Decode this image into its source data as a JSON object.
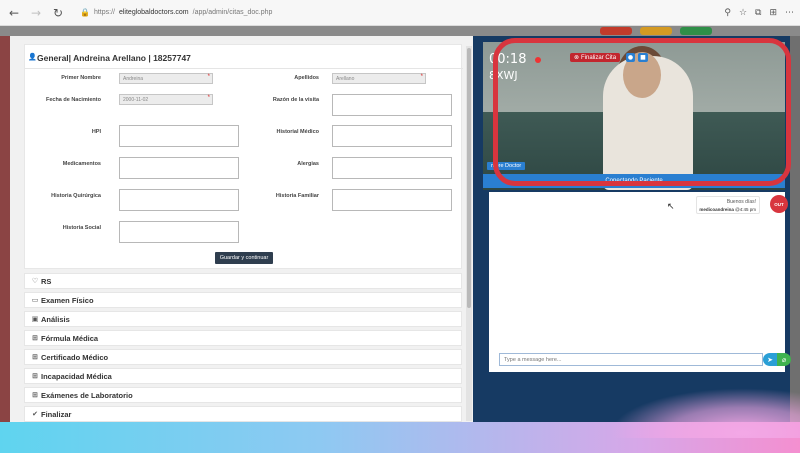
{
  "browser": {
    "url_host": "eliteglobaldoctors.com",
    "url_path": "/app/admin/citas_doc.php",
    "url_scheme": "https://"
  },
  "form": {
    "title": "General| Andreina Arellano | 18257747",
    "fields": {
      "primer_nombre": {
        "label": "Primer Nombre",
        "value": "Andreina"
      },
      "apellidos": {
        "label": "Apellidos",
        "value": "Arellano"
      },
      "fecha_nacimiento": {
        "label": "Fecha de Nacimiento",
        "value": "2000-11-02"
      },
      "razon_visita": {
        "label": "Razón de la visita",
        "value": ""
      },
      "hpi": {
        "label": "HPI",
        "value": ""
      },
      "historial_medico": {
        "label": "Historial Médico",
        "value": ""
      },
      "medicamentos": {
        "label": "Medicamentos",
        "value": ""
      },
      "alergias": {
        "label": "Alergias",
        "value": ""
      },
      "historia_quirurgica": {
        "label": "Historia Quirúrgica",
        "value": ""
      },
      "historia_familiar": {
        "label": "Historia Familiar",
        "value": ""
      },
      "historia_social": {
        "label": "Historia Social",
        "value": ""
      }
    },
    "save_label": "Guardar y continuar"
  },
  "accordion": [
    {
      "label": "RS",
      "icon": "stethoscope-icon"
    },
    {
      "label": "Examen Físico",
      "icon": "id-card-icon"
    },
    {
      "label": "Análisis",
      "icon": "flask-icon"
    },
    {
      "label": "Fórmula Médica",
      "icon": "plus-square-icon"
    },
    {
      "label": "Certificado Médico",
      "icon": "plus-square-icon"
    },
    {
      "label": "Incapacidad Médica",
      "icon": "plus-square-icon"
    },
    {
      "label": "Exámenes de Laboratorio",
      "icon": "plus-square-icon"
    },
    {
      "label": "Finalizar",
      "icon": "check-icon"
    }
  ],
  "video": {
    "timer": "00:18",
    "code": "8XWJ",
    "end_label": "Finalizar Cita",
    "name_tag": "mbre Doctor",
    "bottom_label": "Conectando Paciente"
  },
  "chat": {
    "message_text": "Buenos días!",
    "message_sender": "medicoandreina",
    "message_time": "@4:45 pm",
    "avatar_label": "OUT",
    "input_placeholder": "Type a message here..."
  }
}
